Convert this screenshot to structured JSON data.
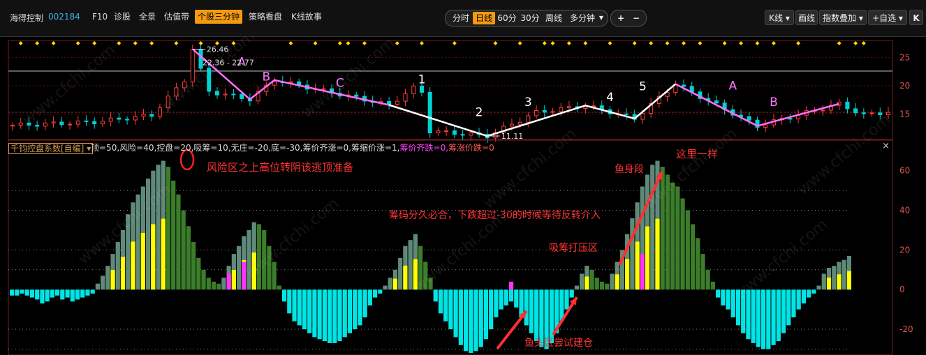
{
  "toolbar": {
    "stock_name": "海得控制",
    "stock_code": "002184",
    "items": [
      "F10",
      "诊股",
      "全景",
      "估值带",
      "个股三分钟",
      "策略看盘",
      "K线故事"
    ],
    "active_item": "个股三分钟",
    "periods": [
      "分时",
      "日线",
      "60分",
      "30分",
      "周线",
      "多分钟"
    ],
    "active_period": "日线",
    "zoom_in": "+",
    "zoom_out": "−",
    "right_buttons": [
      "K线",
      "画线",
      "指数叠加",
      "+自选",
      "K"
    ],
    "colors": {
      "accent": "#f39a10",
      "code": "#3fb0e6"
    }
  },
  "indicator_header": {
    "title": "千钧控盘系数[自编]",
    "params": [
      {
        "text": "顶=50,风险=40,控盘=20,吸筹=10,无庄=-20,底=-30,筹价齐涨=0,筹缩价涨=1,",
        "color": "#dddddd"
      },
      {
        "text": "筹价齐跌=0,",
        "color": "#ff44ff"
      },
      {
        "text": "筹涨价跌=0",
        "color": "#ff5a5a"
      }
    ],
    "close": "×"
  },
  "price_chart": {
    "type": "candlestick",
    "y_ticks": [
      15,
      20,
      25
    ],
    "ylim": [
      10.5,
      28
    ],
    "high_label": "26.46",
    "low_label": "11.11",
    "range_label": "22.36 - 22.77",
    "resistance_level": 22.6,
    "support_level": 15.3,
    "wave_labels": [
      {
        "text": "A",
        "i": 28,
        "v": 23.5,
        "color": "#ff77ff"
      },
      {
        "text": "B",
        "i": 31,
        "v": 20.9,
        "color": "#ff77ff"
      },
      {
        "text": "C",
        "i": 40,
        "v": 19.8,
        "color": "#ff77ff"
      },
      {
        "text": "1",
        "i": 50,
        "v": 20.4,
        "color": "#ffffff"
      },
      {
        "text": "2",
        "i": 57,
        "v": 14.6,
        "color": "#ffffff"
      },
      {
        "text": "3",
        "i": 63,
        "v": 16.4,
        "color": "#ffffff"
      },
      {
        "text": "4",
        "i": 73,
        "v": 17.3,
        "color": "#ffffff"
      },
      {
        "text": "5",
        "i": 77,
        "v": 19.2,
        "color": "#ffffff"
      },
      {
        "text": "A",
        "i": 88,
        "v": 19.3,
        "color": "#ff77ff"
      },
      {
        "text": "B",
        "i": 93,
        "v": 16.4,
        "color": "#ff77ff"
      }
    ],
    "waves_magenta": [
      [
        [
          22,
          26.46
        ],
        [
          29,
          17.6
        ],
        [
          32,
          21.0
        ],
        [
          46,
          16.6
        ]
      ],
      [
        [
          81,
          20.3
        ],
        [
          91,
          12.9
        ],
        [
          101,
          16.8
        ]
      ]
    ],
    "waves_white": [
      [
        [
          46,
          16.6
        ],
        [
          58,
          11.11
        ],
        [
          70,
          16.5
        ],
        [
          76,
          14.2
        ],
        [
          81,
          20.3
        ]
      ]
    ],
    "signal_markers": [
      1,
      3,
      5,
      8,
      10,
      13,
      15,
      17,
      20,
      23,
      25,
      27,
      34,
      37,
      40,
      41,
      43,
      47,
      50,
      54,
      59,
      62,
      65,
      66,
      68,
      70,
      73,
      76,
      78,
      80,
      82,
      84,
      87,
      89,
      91,
      93,
      96,
      101,
      103,
      104
    ]
  },
  "chart_data": {
    "type": "bar",
    "title": "千钧控盘系数",
    "y_ticks": [
      -20,
      0,
      20,
      40,
      60
    ],
    "ylim": [
      -33,
      68
    ],
    "reference_lines": [
      50,
      40,
      20,
      10,
      -20,
      -30
    ],
    "values": [
      -3,
      -3,
      -2,
      -3,
      -4,
      -5,
      -7,
      -6,
      -4,
      -3,
      -5,
      -4,
      -6,
      -5,
      -4,
      -3,
      -2,
      3,
      7,
      12,
      18,
      24,
      30,
      38,
      44,
      48,
      52,
      56,
      60,
      63,
      65,
      62,
      55,
      48,
      40,
      32,
      24,
      16,
      10,
      6,
      4,
      3,
      6,
      12,
      18,
      22,
      27,
      30,
      34,
      33,
      30,
      22,
      14,
      2,
      -6,
      -12,
      -16,
      -18,
      -20,
      -22,
      -24,
      -25,
      -26,
      -27,
      -27,
      -26,
      -24,
      -22,
      -20,
      -18,
      -14,
      -8,
      -4,
      -2,
      2,
      6,
      10,
      16,
      22,
      25,
      28,
      22,
      14,
      6,
      -6,
      -12,
      -16,
      -20,
      -24,
      -28,
      -31,
      -32,
      -31,
      -29,
      -25,
      -20,
      -14,
      -10,
      -8,
      -6,
      -9,
      -14,
      -18,
      -22,
      -26,
      -29,
      -30,
      -27,
      -22,
      -16,
      -10,
      -4,
      2,
      8,
      12,
      10,
      6,
      4,
      3,
      8,
      14,
      20,
      28,
      36,
      44,
      52,
      58,
      63,
      65,
      62,
      58,
      54,
      52,
      46,
      40,
      33,
      26,
      18,
      10,
      4,
      -4,
      -8,
      -10,
      -14,
      -18,
      -22,
      -25,
      -27,
      -29,
      -30,
      -30,
      -28,
      -26,
      -22,
      -18,
      -14,
      -10,
      -7,
      -4,
      -2,
      2,
      8,
      11,
      12,
      14,
      15,
      17
    ],
    "annotations": [
      {
        "text": "风险区之上高位转阴该逃顶准备",
        "color": "#ff3333"
      },
      {
        "text": "这里一样",
        "color": "#ff3333"
      },
      {
        "text": "鱼身段",
        "color": "#ff3333"
      },
      {
        "text": "筹码分久必合，下跌超过-30的时候等待反转介入",
        "color": "#ff3333"
      },
      {
        "text": "吸筹打压区",
        "color": "#ff3333"
      },
      {
        "text": "鱼头区尝试建仓",
        "color": "#ff3333"
      }
    ],
    "colors": {
      "negative": "#00e5e5",
      "positive": "#5f8a7a",
      "green": "#3b7d2a",
      "yellow": "#ffff00",
      "magenta": "#ff33ff"
    }
  },
  "watermark": "www.cfchi.com"
}
